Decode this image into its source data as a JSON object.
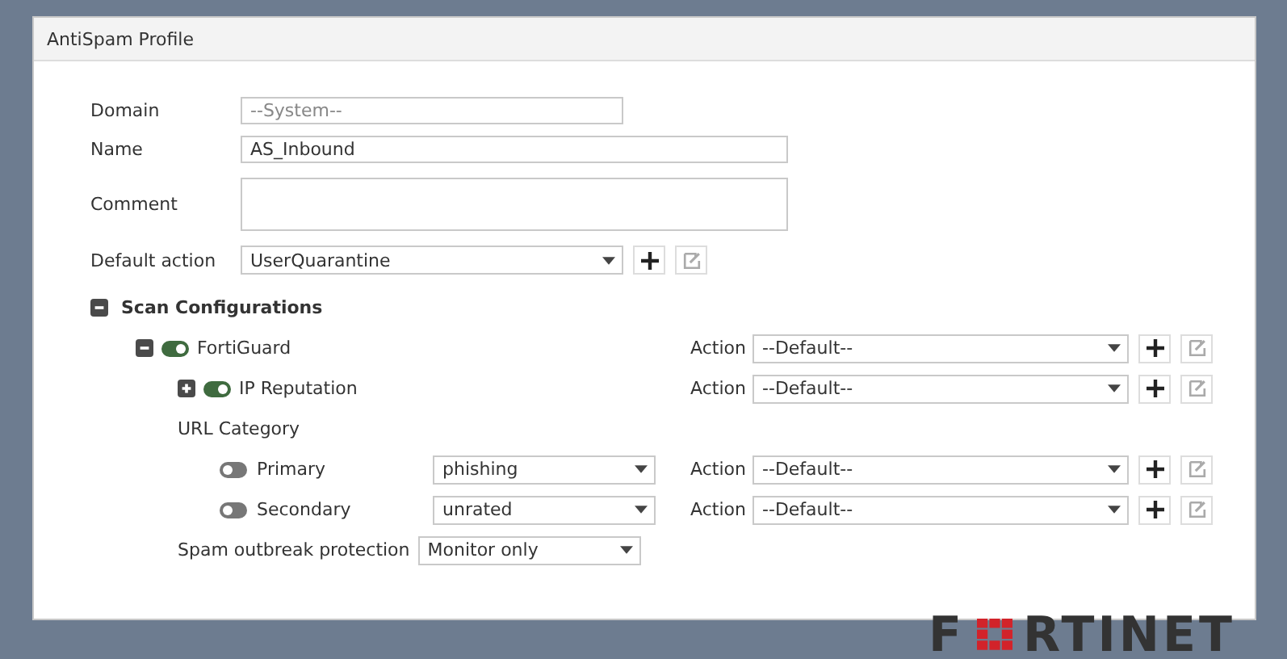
{
  "panel": {
    "title": "AntiSpam Profile"
  },
  "fields": [
    {
      "kind": "readonly",
      "label": "Domain",
      "value": "--System--"
    },
    {
      "kind": "text",
      "label": "Name",
      "value": "AS_Inbound"
    },
    {
      "kind": "textarea",
      "label": "Comment"
    },
    {
      "kind": "select",
      "label": "Default action",
      "value": "UserQuarantine"
    }
  ],
  "scan": {
    "label": "Scan Configurations",
    "expanded": true,
    "rows": [
      {
        "kind": "toggle",
        "label": "FortiGuard",
        "expanded": true,
        "on": true,
        "action_label": "Action",
        "action": "--Default--",
        "children": [
          {
            "kind": "toggle",
            "label": "IP Reputation",
            "expanded": false,
            "on": true,
            "action_label": "Action",
            "action": "--Default--"
          },
          {
            "kind": "heading",
            "label": "URL Category",
            "children": [
              {
                "kind": "category",
                "label": "Primary",
                "on": false,
                "value": "phishing",
                "action_label": "Action",
                "action": "--Default--"
              },
              {
                "kind": "category",
                "label": "Secondary",
                "on": false,
                "value": "unrated",
                "action_label": "Action",
                "action": "--Default--"
              }
            ]
          },
          {
            "kind": "select",
            "label": "Spam outbreak protection",
            "value": "Monitor only"
          }
        ]
      }
    ]
  },
  "logo": {
    "text_before": "F",
    "text_after": "RTINET"
  }
}
